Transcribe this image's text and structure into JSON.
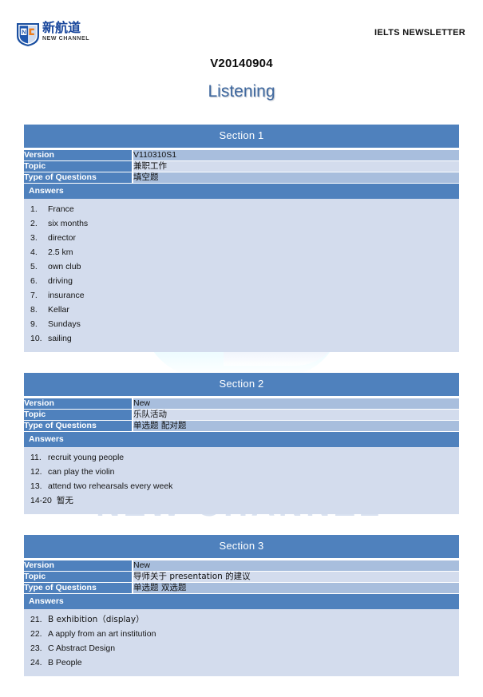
{
  "header": {
    "logo_cn": "新航道",
    "logo_en": "NEW CHANNEL",
    "logo_mark": "NC",
    "newsletter_label": "IELTS NEWSLETTER"
  },
  "title": {
    "code": "V20140904",
    "subtitle": "Listening"
  },
  "watermark": {
    "text": "NEW CHANNEL"
  },
  "labels": {
    "version": "Version",
    "topic": "Topic",
    "type_of_questions": "Type of Questions",
    "answers": "Answers"
  },
  "colors": {
    "header_blue": "#4f81bd",
    "band_dark": "#a8bedd",
    "band_light": "#d3dced",
    "subtitle_blue": "#40699f",
    "logo_blue": "#17459b"
  },
  "sections": [
    {
      "title": "Section 1",
      "version": "V110310S1",
      "topic": "兼职工作",
      "type_of_questions": "填空题",
      "answers": [
        {
          "num": "1.",
          "text": "France"
        },
        {
          "num": "2.",
          "text": "six months"
        },
        {
          "num": "3.",
          "text": "director"
        },
        {
          "num": "4.",
          "text": "2.5 km"
        },
        {
          "num": "5.",
          "text": "own club"
        },
        {
          "num": "6.",
          "text": "driving"
        },
        {
          "num": "7.",
          "text": "insurance"
        },
        {
          "num": "8.",
          "text": "Kellar"
        },
        {
          "num": "9.",
          "text": "Sundays"
        },
        {
          "num": "10.",
          "text": "sailing"
        }
      ]
    },
    {
      "title": "Section 2",
      "version": "New",
      "topic": "乐队活动",
      "type_of_questions": "单选题  配对题",
      "answers": [
        {
          "num": "11.",
          "text": "recruit young people"
        },
        {
          "num": "12.",
          "text": "can play the violin"
        },
        {
          "num": "13.",
          "text": "attend two rehearsals every week"
        },
        {
          "num": "14-20",
          "text": "暂无"
        }
      ]
    },
    {
      "title": "Section 3",
      "version": "New",
      "topic": "导师关于 presentation 的建议",
      "type_of_questions": "单选题  双选题",
      "answers": [
        {
          "num": "21.",
          "text": "B exhibition（display）"
        },
        {
          "num": "22.",
          "text": "A apply from an art institution"
        },
        {
          "num": "23.",
          "text": "C Abstract Design"
        },
        {
          "num": "24.",
          "text": "B People"
        }
      ]
    }
  ]
}
